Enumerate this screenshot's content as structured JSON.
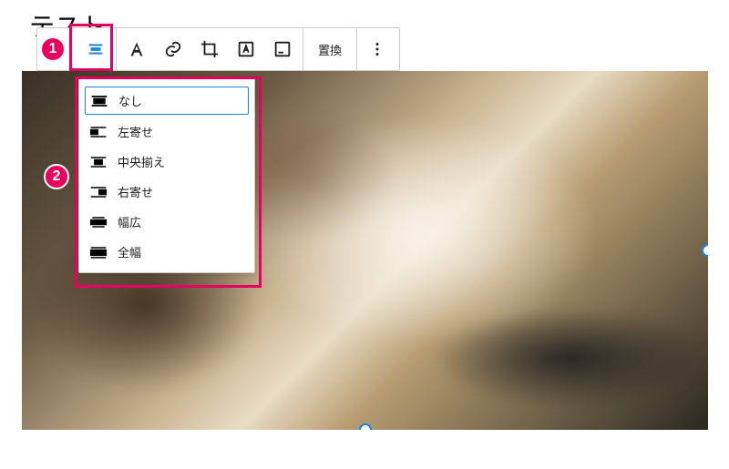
{
  "page_title_partial": "テスト",
  "toolbar": {
    "replace_label": "置換"
  },
  "alignment_menu": {
    "items": [
      {
        "label": "なし"
      },
      {
        "label": "左寄せ"
      },
      {
        "label": "中央揃え"
      },
      {
        "label": "右寄せ"
      },
      {
        "label": "幅広"
      },
      {
        "label": "全幅"
      }
    ]
  },
  "callouts": {
    "one": "1",
    "two": "2"
  }
}
